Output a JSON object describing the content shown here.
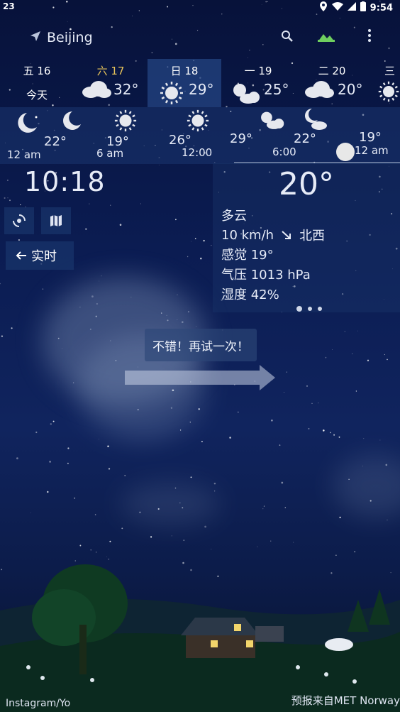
{
  "status_bar": {
    "notification": "23",
    "time": "9:54"
  },
  "location": {
    "city": "Beijing"
  },
  "days": [
    {
      "label": "五 16",
      "sub": "今天",
      "temp": "",
      "icon": "none",
      "active": false
    },
    {
      "label": "六 17",
      "sub": "",
      "temp": "32°",
      "icon": "cloud-icon",
      "active": false
    },
    {
      "label": "日 18",
      "sub": "",
      "temp": "29°",
      "icon": "sun-icon",
      "active": true
    },
    {
      "label": "一 19",
      "sub": "",
      "temp": "25°",
      "icon": "partly-sunny-icon",
      "active": false
    },
    {
      "label": "二 20",
      "sub": "",
      "temp": "20°",
      "icon": "cloud-icon",
      "active": false
    },
    {
      "label": "三",
      "sub": "",
      "temp": "",
      "icon": "sun-icon",
      "active": false
    }
  ],
  "hourly": [
    {
      "temp": "22°",
      "time": "12 am",
      "icon": "moon-icon"
    },
    {
      "temp": "19°",
      "time": "6 am",
      "icon": "sun-icon"
    },
    {
      "temp": "26°",
      "time": "12:00",
      "icon": "sun-icon"
    },
    {
      "temp": "29°",
      "time": "",
      "icon": "sun-icon"
    },
    {
      "temp": "22°",
      "time": "6:00",
      "icon": "partly-sunny-icon"
    },
    {
      "temp": "19°",
      "time": "12 am",
      "icon": "moon-cloud-icon"
    }
  ],
  "current": {
    "time": "10:18",
    "temperature": "20°",
    "condition": "多云",
    "wind_speed": "10 km/h",
    "wind_direction": "北西",
    "feels_like": "感觉 19°",
    "pressure": "气压 1013 hPa",
    "humidity": "湿度 42%"
  },
  "realtime_button": {
    "label": "实时"
  },
  "tutorial": {
    "message": "不错！再试一次！"
  },
  "footer": {
    "credit_left": "Instagram/Yo",
    "credit_right": "预报来自MET Norway"
  },
  "colors": {
    "sky_top": "#07123a",
    "sky_mid": "#10245e",
    "accent": "#6fcf5f",
    "sun": "#e8e8e8"
  }
}
